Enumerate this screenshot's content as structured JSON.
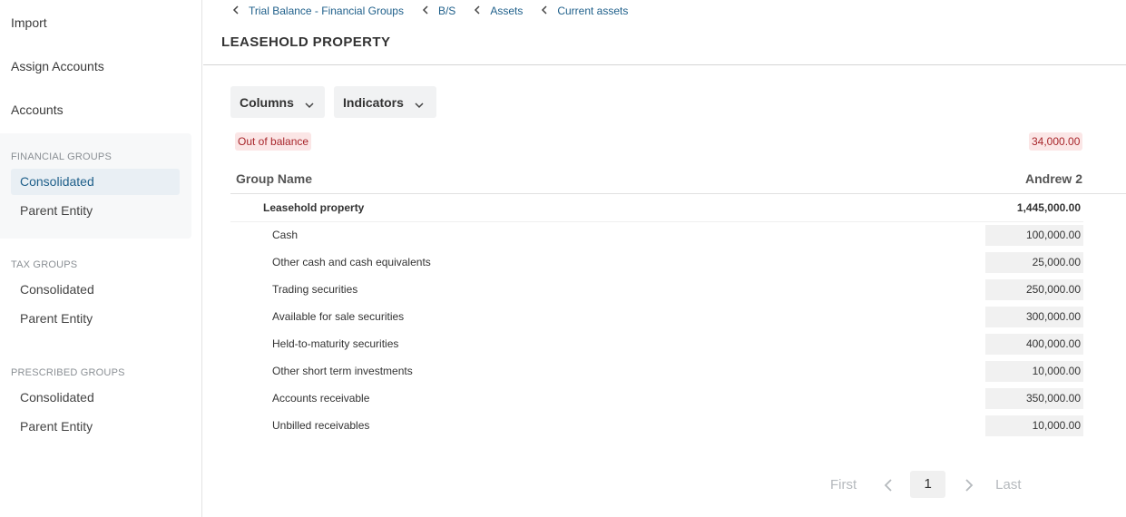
{
  "sidebar": {
    "top_links": [
      "Import",
      "Assign Accounts",
      "Accounts"
    ],
    "financial_groups": {
      "heading": "FINANCIAL GROUPS",
      "items": [
        "Consolidated",
        "Parent Entity"
      ]
    },
    "tax_groups": {
      "heading": "TAX GROUPS",
      "items": [
        "Consolidated",
        "Parent Entity"
      ]
    },
    "prescribed_groups": {
      "heading": "PRESCRIBED GROUPS",
      "items": [
        "Consolidated",
        "Parent Entity"
      ]
    },
    "active_item": "financial_groups.Consolidated"
  },
  "breadcrumb": [
    "Trial Balance - Financial Groups",
    "B/S",
    "Assets",
    "Current assets"
  ],
  "page_title": "LEASEHOLD PROPERTY",
  "toolbar": {
    "columns_label": "Columns",
    "indicators_label": "Indicators"
  },
  "status": {
    "badge": "Out of balance",
    "difference": "34,000.00"
  },
  "table": {
    "headers": {
      "name": "Group Name",
      "column": "Andrew 2"
    },
    "parent": {
      "name": "Leasehold property",
      "value": "1,445,000.00"
    },
    "rows": [
      {
        "name": "Cash",
        "value": "100,000.00"
      },
      {
        "name": "Other cash and cash equivalents",
        "value": "25,000.00"
      },
      {
        "name": "Trading securities",
        "value": "250,000.00"
      },
      {
        "name": "Available for sale securities",
        "value": "300,000.00"
      },
      {
        "name": "Held-to-maturity securities",
        "value": "400,000.00"
      },
      {
        "name": "Other short term investments",
        "value": "10,000.00"
      },
      {
        "name": "Accounts receivable",
        "value": "350,000.00"
      },
      {
        "name": "Unbilled receivables",
        "value": "10,000.00"
      }
    ]
  },
  "pagination": {
    "first": "First",
    "last": "Last",
    "current": "1"
  },
  "colors": {
    "link": "#1e5f8a",
    "badge_bg": "#fbe6e6",
    "badge_text": "#a8262b",
    "active_bg": "#e9eff4"
  },
  "icons": {
    "breadcrumb": "chevron-left-icon",
    "dropdown": "chevron-down-icon",
    "prev": "chevron-left-icon",
    "next": "chevron-right-icon"
  }
}
